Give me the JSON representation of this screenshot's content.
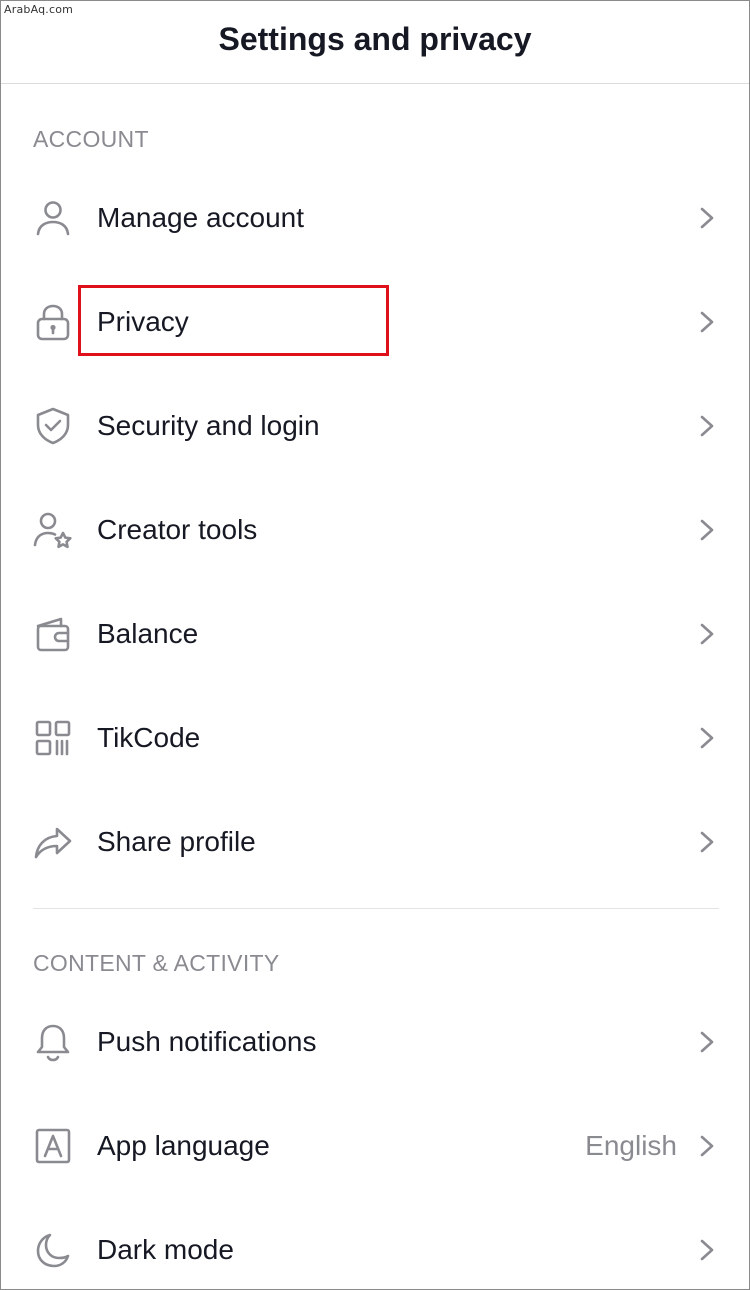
{
  "watermark": "ArabAq.com",
  "header": {
    "title": "Settings and privacy"
  },
  "sections": [
    {
      "label": "ACCOUNT",
      "items": [
        {
          "label": "Manage account",
          "icon": "person-icon"
        },
        {
          "label": "Privacy",
          "icon": "lock-icon"
        },
        {
          "label": "Security and login",
          "icon": "shield-icon"
        },
        {
          "label": "Creator tools",
          "icon": "person-star-icon"
        },
        {
          "label": "Balance",
          "icon": "wallet-icon"
        },
        {
          "label": "TikCode",
          "icon": "qr-code-icon"
        },
        {
          "label": "Share profile",
          "icon": "share-arrow-icon"
        }
      ]
    },
    {
      "label": "CONTENT & ACTIVITY",
      "items": [
        {
          "label": "Push notifications",
          "icon": "bell-icon"
        },
        {
          "label": "App language",
          "icon": "language-icon",
          "value": "English"
        },
        {
          "label": "Dark mode",
          "icon": "moon-icon"
        }
      ]
    }
  ],
  "annotation": {
    "highlighted_item": "Privacy",
    "color": "#e0101a"
  },
  "colors": {
    "text_primary": "#161823",
    "text_secondary": "#8a8b91",
    "icon": "#8a8b91"
  }
}
